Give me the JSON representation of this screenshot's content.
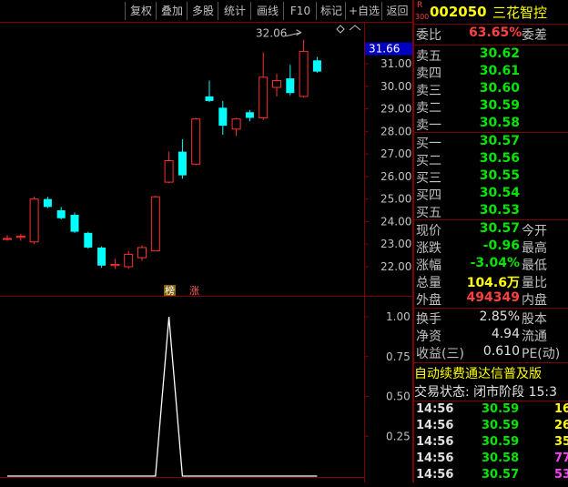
{
  "toolbar": {
    "buttons": [
      "复权",
      "叠加",
      "多股",
      "统计",
      "画线",
      "F10",
      "标记",
      "+自选",
      "返回"
    ]
  },
  "chart": {
    "price_axis_labels": [
      "31.00",
      "30.00",
      "29.00",
      "28.00",
      "27.00",
      "26.00",
      "25.00",
      "24.00",
      "23.00",
      "22.00"
    ],
    "current_price_tag": "31.66",
    "high_annotation": "32.06",
    "indicator_axis_labels": [
      "1.00",
      "0.75",
      "0.50",
      "0.25"
    ],
    "marker_1": "榜",
    "marker_2": "涨",
    "colors": {
      "up": "#ff3030",
      "down": "#00ffff",
      "axis": "#800000",
      "grid": "#5a0000"
    }
  },
  "chart_data": {
    "type": "candlestick",
    "title": "",
    "ylim": [
      21.5,
      32.5
    ],
    "candles": [
      {
        "open": 23.25,
        "high": 23.4,
        "low": 23.15,
        "close": 23.25
      },
      {
        "open": 23.3,
        "high": 23.45,
        "low": 23.15,
        "close": 23.35
      },
      {
        "open": 23.1,
        "high": 25.1,
        "low": 23.0,
        "close": 25.0
      },
      {
        "open": 25.0,
        "high": 25.1,
        "low": 24.6,
        "close": 24.65
      },
      {
        "open": 24.5,
        "high": 24.65,
        "low": 24.1,
        "close": 24.15
      },
      {
        "open": 24.3,
        "high": 24.4,
        "low": 23.5,
        "close": 23.55
      },
      {
        "open": 23.5,
        "high": 23.55,
        "low": 22.8,
        "close": 22.85
      },
      {
        "open": 22.85,
        "high": 22.9,
        "low": 21.95,
        "close": 22.05
      },
      {
        "open": 22.05,
        "high": 22.35,
        "low": 21.9,
        "close": 22.1
      },
      {
        "open": 22.0,
        "high": 22.7,
        "low": 21.9,
        "close": 22.55
      },
      {
        "open": 22.4,
        "high": 22.95,
        "low": 22.25,
        "close": 22.85
      },
      {
        "open": 22.7,
        "high": 25.15,
        "low": 22.7,
        "close": 25.1
      },
      {
        "open": 25.75,
        "high": 27.1,
        "low": 25.7,
        "close": 26.7
      },
      {
        "open": 27.1,
        "high": 27.65,
        "low": 25.9,
        "close": 26.05
      },
      {
        "open": 26.55,
        "high": 28.6,
        "low": 26.5,
        "close": 28.55
      },
      {
        "open": 29.55,
        "high": 30.25,
        "low": 29.3,
        "close": 29.35
      },
      {
        "open": 29.05,
        "high": 29.35,
        "low": 27.85,
        "close": 28.25
      },
      {
        "open": 28.1,
        "high": 28.6,
        "low": 27.8,
        "close": 28.55
      },
      {
        "open": 28.85,
        "high": 28.95,
        "low": 28.45,
        "close": 28.6
      },
      {
        "open": 28.6,
        "high": 31.5,
        "low": 28.5,
        "close": 30.4
      },
      {
        "open": 29.95,
        "high": 30.55,
        "low": 29.55,
        "close": 30.25
      },
      {
        "open": 30.35,
        "high": 30.95,
        "low": 29.6,
        "close": 29.7
      },
      {
        "open": 29.55,
        "high": 32.06,
        "low": 29.5,
        "close": 31.55
      },
      {
        "open": 31.15,
        "high": 31.3,
        "low": 30.6,
        "close": 30.65
      }
    ],
    "indicator": {
      "ylim": [
        0,
        1.15
      ],
      "values": [
        0,
        0,
        0,
        0,
        0,
        0,
        0,
        0,
        0,
        0,
        0,
        0,
        1,
        0,
        0,
        0,
        0,
        0,
        0,
        0,
        0,
        0,
        0,
        0
      ]
    }
  },
  "quote": {
    "r_badge": "R",
    "r_sub": "300",
    "code": "002050",
    "name": "三花智控",
    "weibi_label": "委比",
    "weibi_value": "63.65%",
    "weicha_label": "委差",
    "sell": [
      {
        "label": "卖五",
        "price": "30.62"
      },
      {
        "label": "卖四",
        "price": "30.61"
      },
      {
        "label": "卖三",
        "price": "30.60"
      },
      {
        "label": "卖二",
        "price": "30.59"
      },
      {
        "label": "卖一",
        "price": "30.58"
      }
    ],
    "buy": [
      {
        "label": "买一",
        "price": "30.57"
      },
      {
        "label": "买二",
        "price": "30.56"
      },
      {
        "label": "买三",
        "price": "30.55"
      },
      {
        "label": "买四",
        "price": "30.54"
      },
      {
        "label": "买五",
        "price": "30.53"
      }
    ],
    "stats": [
      {
        "label": "现价",
        "value": "30.57",
        "ext": "今开",
        "color": "green"
      },
      {
        "label": "涨跌",
        "value": "-0.96",
        "ext": "最高",
        "color": "green"
      },
      {
        "label": "涨幅",
        "value": "-3.04%",
        "ext": "最低",
        "color": "green"
      },
      {
        "label": "总量",
        "value": "104.6万",
        "ext": "量比",
        "color": "yellow"
      },
      {
        "label": "外盘",
        "value": "494349",
        "ext": "内盘",
        "color": "red"
      }
    ],
    "stats2": [
      {
        "label": "换手",
        "value": "2.85%",
        "ext": "股本"
      },
      {
        "label": "净资",
        "value": "4.94",
        "ext": "流通"
      },
      {
        "label": "收益(三)",
        "value": "0.610",
        "ext": "PE(动)"
      }
    ],
    "promo": "自动续费通达信普及版",
    "status": "交易状态: 闭市阶段 15:3",
    "ticks": [
      {
        "time": "14:56",
        "price": "30.59",
        "vol": "16",
        "vcolor": "yellow"
      },
      {
        "time": "14:56",
        "price": "30.59",
        "vol": "26",
        "vcolor": "yellow"
      },
      {
        "time": "14:56",
        "price": "30.59",
        "vol": "35",
        "vcolor": "yellow"
      },
      {
        "time": "14:56",
        "price": "30.58",
        "vol": "77",
        "vcolor": "purple"
      },
      {
        "time": "14:56",
        "price": "30.57",
        "vol": "53",
        "vcolor": "purple"
      }
    ]
  }
}
